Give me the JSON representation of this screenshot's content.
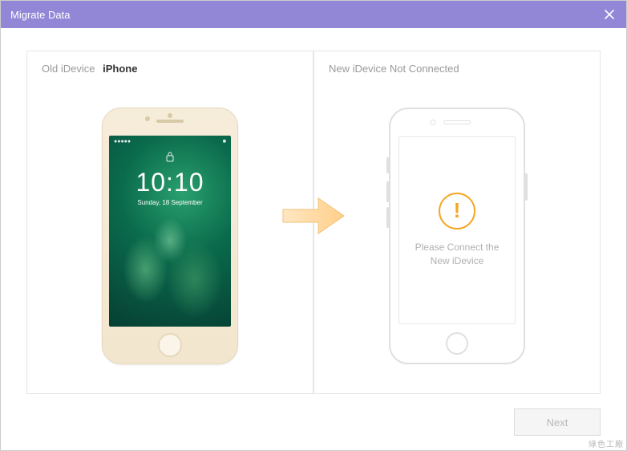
{
  "titlebar": {
    "title": "Migrate Data"
  },
  "left_panel": {
    "label": "Old iDevice",
    "device_name": "iPhone",
    "lockscreen": {
      "time": "10:10",
      "date": "Sunday, 18 September",
      "signal_left": "●●●●●",
      "battery_right": "■"
    }
  },
  "right_panel": {
    "label": "New iDevice Not Connected",
    "warning_glyph": "!",
    "message_line1": "Please Connect the",
    "message_line2": "New iDevice"
  },
  "footer": {
    "next_label": "Next"
  },
  "watermark": "綠色工廠",
  "colors": {
    "accent": "#9287D7",
    "warning": "#f5a623"
  }
}
